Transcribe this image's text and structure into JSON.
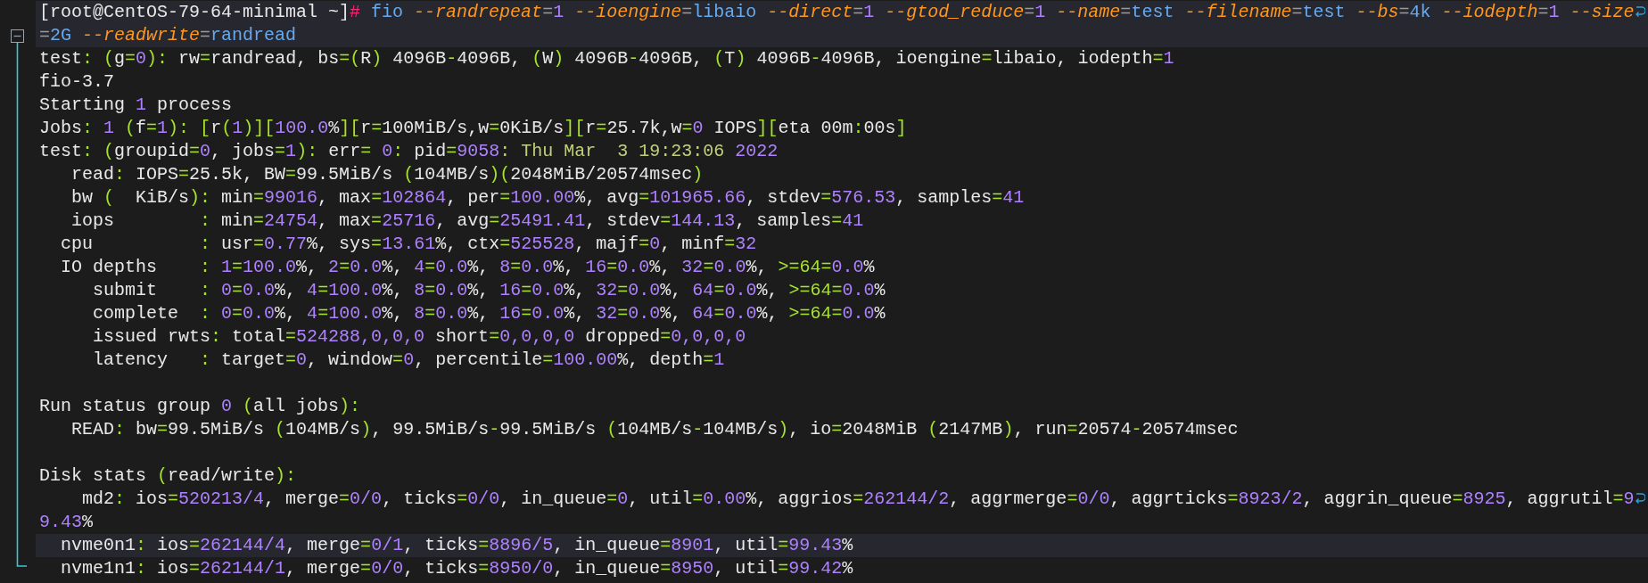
{
  "editor": {
    "fold": {
      "expanded": true
    },
    "lines": [
      {
        "kind": "text",
        "highlighted": true,
        "wrapped": true,
        "tokens": [
          {
            "kind": "plain",
            "text": "[root@CentOS-79-64-minimal ~]"
          },
          {
            "kind": "prompt",
            "text": "#"
          },
          {
            "kind": "command",
            "text": " fio "
          },
          {
            "kind": "flag",
            "text": "--randrepeat"
          },
          {
            "kind": "operator",
            "text": "="
          },
          {
            "kind": "number",
            "text": "1"
          },
          {
            "kind": "flag",
            "text": " --ioengine"
          },
          {
            "kind": "operator",
            "text": "="
          },
          {
            "kind": "value",
            "text": "libaio"
          },
          {
            "kind": "flag",
            "text": " --direct"
          },
          {
            "kind": "operator",
            "text": "="
          },
          {
            "kind": "number",
            "text": "1"
          },
          {
            "kind": "flag",
            "text": " --gtod_reduce"
          },
          {
            "kind": "operator",
            "text": "="
          },
          {
            "kind": "number",
            "text": "1"
          },
          {
            "kind": "flag",
            "text": " --name"
          },
          {
            "kind": "operator",
            "text": "="
          },
          {
            "kind": "value",
            "text": "test"
          },
          {
            "kind": "flag",
            "text": " --filename"
          },
          {
            "kind": "operator",
            "text": "="
          },
          {
            "kind": "value",
            "text": "test"
          },
          {
            "kind": "flag",
            "text": " --bs"
          },
          {
            "kind": "operator",
            "text": "="
          },
          {
            "kind": "value",
            "text": "4k"
          },
          {
            "kind": "flag",
            "text": " --iodepth"
          },
          {
            "kind": "operator",
            "text": "="
          },
          {
            "kind": "number",
            "text": "1"
          },
          {
            "kind": "flag",
            "text": " --size"
          }
        ]
      },
      {
        "kind": "text",
        "highlighted": true,
        "wrapped": false,
        "tokens": [
          {
            "kind": "operator",
            "text": "="
          },
          {
            "kind": "value",
            "text": "2G"
          },
          {
            "kind": "flag",
            "text": " --readwrite"
          },
          {
            "kind": "operator",
            "text": "="
          },
          {
            "kind": "value",
            "text": "randread"
          }
        ]
      },
      {
        "kind": "text",
        "highlighted": false,
        "wrapped": false,
        "tokens": [
          {
            "kind": "plain",
            "text": "test"
          },
          {
            "kind": "punct",
            "text": ": ("
          },
          {
            "kind": "plain",
            "text": "g"
          },
          {
            "kind": "punct",
            "text": "="
          },
          {
            "kind": "number",
            "text": "0"
          },
          {
            "kind": "punct",
            "text": "):"
          },
          {
            "kind": "plain",
            "text": " rw"
          },
          {
            "kind": "punct",
            "text": "="
          },
          {
            "kind": "plain",
            "text": "randread, bs"
          },
          {
            "kind": "punct",
            "text": "=("
          },
          {
            "kind": "plain",
            "text": "R"
          },
          {
            "kind": "punct",
            "text": ")"
          },
          {
            "kind": "plain",
            "text": " 4096B"
          },
          {
            "kind": "punct",
            "text": "-"
          },
          {
            "kind": "plain",
            "text": "4096B, "
          },
          {
            "kind": "punct",
            "text": "("
          },
          {
            "kind": "plain",
            "text": "W"
          },
          {
            "kind": "punct",
            "text": ")"
          },
          {
            "kind": "plain",
            "text": " 4096B"
          },
          {
            "kind": "punct",
            "text": "-"
          },
          {
            "kind": "plain",
            "text": "4096B, "
          },
          {
            "kind": "punct",
            "text": "("
          },
          {
            "kind": "plain",
            "text": "T"
          },
          {
            "kind": "punct",
            "text": ")"
          },
          {
            "kind": "plain",
            "text": " 4096B"
          },
          {
            "kind": "punct",
            "text": "-"
          },
          {
            "kind": "plain",
            "text": "4096B, ioengine"
          },
          {
            "kind": "punct",
            "text": "="
          },
          {
            "kind": "plain",
            "text": "libaio, iodepth"
          },
          {
            "kind": "punct",
            "text": "="
          },
          {
            "kind": "number",
            "text": "1"
          }
        ]
      },
      {
        "kind": "text",
        "highlighted": false,
        "wrapped": false,
        "tokens": [
          {
            "kind": "plain",
            "text": "fio-3.7"
          }
        ]
      },
      {
        "kind": "text",
        "highlighted": false,
        "wrapped": false,
        "tokens": [
          {
            "kind": "plain",
            "text": "Starting "
          },
          {
            "kind": "number",
            "text": "1"
          },
          {
            "kind": "plain",
            "text": " process"
          }
        ]
      },
      {
        "kind": "text",
        "highlighted": false,
        "wrapped": false,
        "tokens": [
          {
            "kind": "plain",
            "text": "Jobs"
          },
          {
            "kind": "punct",
            "text": ": "
          },
          {
            "kind": "number",
            "text": "1"
          },
          {
            "kind": "punct",
            "text": " ("
          },
          {
            "kind": "plain",
            "text": "f"
          },
          {
            "kind": "punct",
            "text": "="
          },
          {
            "kind": "number",
            "text": "1"
          },
          {
            "kind": "punct",
            "text": "): ["
          },
          {
            "kind": "plain",
            "text": "r"
          },
          {
            "kind": "punct",
            "text": "("
          },
          {
            "kind": "number",
            "text": "1"
          },
          {
            "kind": "punct",
            "text": ")]["
          },
          {
            "kind": "number",
            "text": "100.0"
          },
          {
            "kind": "plain",
            "text": "%"
          },
          {
            "kind": "punct",
            "text": "]["
          },
          {
            "kind": "plain",
            "text": "r"
          },
          {
            "kind": "punct",
            "text": "="
          },
          {
            "kind": "plain",
            "text": "100MiB/s,w"
          },
          {
            "kind": "punct",
            "text": "="
          },
          {
            "kind": "plain",
            "text": "0KiB/s"
          },
          {
            "kind": "punct",
            "text": "]["
          },
          {
            "kind": "plain",
            "text": "r"
          },
          {
            "kind": "punct",
            "text": "="
          },
          {
            "kind": "plain",
            "text": "25.7k,w"
          },
          {
            "kind": "punct",
            "text": "="
          },
          {
            "kind": "number",
            "text": "0"
          },
          {
            "kind": "plain",
            "text": " IOPS"
          },
          {
            "kind": "punct",
            "text": "]["
          },
          {
            "kind": "plain",
            "text": "eta 00m"
          },
          {
            "kind": "punct",
            "text": ":"
          },
          {
            "kind": "plain",
            "text": "00s"
          },
          {
            "kind": "punct",
            "text": "]"
          }
        ]
      },
      {
        "kind": "text",
        "highlighted": false,
        "wrapped": false,
        "tokens": [
          {
            "kind": "plain",
            "text": "test"
          },
          {
            "kind": "punct",
            "text": ": ("
          },
          {
            "kind": "plain",
            "text": "groupid"
          },
          {
            "kind": "punct",
            "text": "="
          },
          {
            "kind": "number",
            "text": "0"
          },
          {
            "kind": "plain",
            "text": ", jobs"
          },
          {
            "kind": "punct",
            "text": "="
          },
          {
            "kind": "number",
            "text": "1"
          },
          {
            "kind": "punct",
            "text": "):"
          },
          {
            "kind": "plain",
            "text": " err"
          },
          {
            "kind": "punct",
            "text": "="
          },
          {
            "kind": "number",
            "text": " 0"
          },
          {
            "kind": "punct",
            "text": ":"
          },
          {
            "kind": "plain",
            "text": " pid"
          },
          {
            "kind": "punct",
            "text": "="
          },
          {
            "kind": "number",
            "text": "9058"
          },
          {
            "kind": "date",
            "text": ": Thu Mar  3 19:23:06 "
          },
          {
            "kind": "number",
            "text": "2022"
          }
        ]
      },
      {
        "kind": "text",
        "highlighted": false,
        "wrapped": false,
        "tokens": [
          {
            "kind": "plain",
            "text": "   read"
          },
          {
            "kind": "punct",
            "text": ":"
          },
          {
            "kind": "plain",
            "text": " IOPS"
          },
          {
            "kind": "punct",
            "text": "="
          },
          {
            "kind": "plain",
            "text": "25.5k, BW"
          },
          {
            "kind": "punct",
            "text": "="
          },
          {
            "kind": "plain",
            "text": "99.5MiB/s "
          },
          {
            "kind": "punct",
            "text": "("
          },
          {
            "kind": "plain",
            "text": "104MB/s"
          },
          {
            "kind": "punct",
            "text": ")("
          },
          {
            "kind": "plain",
            "text": "2048MiB/20574msec"
          },
          {
            "kind": "punct",
            "text": ")"
          }
        ]
      },
      {
        "kind": "text",
        "highlighted": false,
        "wrapped": false,
        "tokens": [
          {
            "kind": "plain",
            "text": "   bw "
          },
          {
            "kind": "punct",
            "text": "("
          },
          {
            "kind": "plain",
            "text": "  KiB/s"
          },
          {
            "kind": "punct",
            "text": "):"
          },
          {
            "kind": "plain",
            "text": " min"
          },
          {
            "kind": "punct",
            "text": "="
          },
          {
            "kind": "number",
            "text": "99016"
          },
          {
            "kind": "plain",
            "text": ", max"
          },
          {
            "kind": "punct",
            "text": "="
          },
          {
            "kind": "number",
            "text": "102864"
          },
          {
            "kind": "plain",
            "text": ", per"
          },
          {
            "kind": "punct",
            "text": "="
          },
          {
            "kind": "number",
            "text": "100.00"
          },
          {
            "kind": "plain",
            "text": "%, avg"
          },
          {
            "kind": "punct",
            "text": "="
          },
          {
            "kind": "number",
            "text": "101965.66"
          },
          {
            "kind": "plain",
            "text": ", stdev"
          },
          {
            "kind": "punct",
            "text": "="
          },
          {
            "kind": "number",
            "text": "576.53"
          },
          {
            "kind": "plain",
            "text": ", samples"
          },
          {
            "kind": "punct",
            "text": "="
          },
          {
            "kind": "number",
            "text": "41"
          }
        ]
      },
      {
        "kind": "text",
        "highlighted": false,
        "wrapped": false,
        "tokens": [
          {
            "kind": "plain",
            "text": "   iops        "
          },
          {
            "kind": "punct",
            "text": ":"
          },
          {
            "kind": "plain",
            "text": " min"
          },
          {
            "kind": "punct",
            "text": "="
          },
          {
            "kind": "number",
            "text": "24754"
          },
          {
            "kind": "plain",
            "text": ", max"
          },
          {
            "kind": "punct",
            "text": "="
          },
          {
            "kind": "number",
            "text": "25716"
          },
          {
            "kind": "plain",
            "text": ", avg"
          },
          {
            "kind": "punct",
            "text": "="
          },
          {
            "kind": "number",
            "text": "25491.41"
          },
          {
            "kind": "plain",
            "text": ", stdev"
          },
          {
            "kind": "punct",
            "text": "="
          },
          {
            "kind": "number",
            "text": "144.13"
          },
          {
            "kind": "plain",
            "text": ", samples"
          },
          {
            "kind": "punct",
            "text": "="
          },
          {
            "kind": "number",
            "text": "41"
          }
        ]
      },
      {
        "kind": "text",
        "highlighted": false,
        "wrapped": false,
        "tokens": [
          {
            "kind": "plain",
            "text": "  cpu          "
          },
          {
            "kind": "punct",
            "text": ":"
          },
          {
            "kind": "plain",
            "text": " usr"
          },
          {
            "kind": "punct",
            "text": "="
          },
          {
            "kind": "number",
            "text": "0.77"
          },
          {
            "kind": "plain",
            "text": "%, sys"
          },
          {
            "kind": "punct",
            "text": "="
          },
          {
            "kind": "number",
            "text": "13.61"
          },
          {
            "kind": "plain",
            "text": "%, ctx"
          },
          {
            "kind": "punct",
            "text": "="
          },
          {
            "kind": "number",
            "text": "525528"
          },
          {
            "kind": "plain",
            "text": ", majf"
          },
          {
            "kind": "punct",
            "text": "="
          },
          {
            "kind": "number",
            "text": "0"
          },
          {
            "kind": "plain",
            "text": ", minf"
          },
          {
            "kind": "punct",
            "text": "="
          },
          {
            "kind": "number",
            "text": "32"
          }
        ]
      },
      {
        "kind": "text",
        "highlighted": false,
        "wrapped": false,
        "tokens": [
          {
            "kind": "plain",
            "text": "  IO depths    "
          },
          {
            "kind": "punct",
            "text": ": "
          },
          {
            "kind": "number",
            "text": "1"
          },
          {
            "kind": "punct",
            "text": "="
          },
          {
            "kind": "number",
            "text": "100.0"
          },
          {
            "kind": "plain",
            "text": "%, "
          },
          {
            "kind": "number",
            "text": "2"
          },
          {
            "kind": "punct",
            "text": "="
          },
          {
            "kind": "number",
            "text": "0.0"
          },
          {
            "kind": "plain",
            "text": "%, "
          },
          {
            "kind": "number",
            "text": "4"
          },
          {
            "kind": "punct",
            "text": "="
          },
          {
            "kind": "number",
            "text": "0.0"
          },
          {
            "kind": "plain",
            "text": "%, "
          },
          {
            "kind": "number",
            "text": "8"
          },
          {
            "kind": "punct",
            "text": "="
          },
          {
            "kind": "number",
            "text": "0.0"
          },
          {
            "kind": "plain",
            "text": "%, "
          },
          {
            "kind": "number",
            "text": "16"
          },
          {
            "kind": "punct",
            "text": "="
          },
          {
            "kind": "number",
            "text": "0.0"
          },
          {
            "kind": "plain",
            "text": "%, "
          },
          {
            "kind": "number",
            "text": "32"
          },
          {
            "kind": "punct",
            "text": "="
          },
          {
            "kind": "number",
            "text": "0.0"
          },
          {
            "kind": "plain",
            "text": "%, "
          },
          {
            "kind": "punct",
            "text": ">=64="
          },
          {
            "kind": "number",
            "text": "0.0"
          },
          {
            "kind": "plain",
            "text": "%"
          }
        ]
      },
      {
        "kind": "text",
        "highlighted": false,
        "wrapped": false,
        "tokens": [
          {
            "kind": "plain",
            "text": "     submit    "
          },
          {
            "kind": "punct",
            "text": ": "
          },
          {
            "kind": "number",
            "text": "0"
          },
          {
            "kind": "punct",
            "text": "="
          },
          {
            "kind": "number",
            "text": "0.0"
          },
          {
            "kind": "plain",
            "text": "%, "
          },
          {
            "kind": "number",
            "text": "4"
          },
          {
            "kind": "punct",
            "text": "="
          },
          {
            "kind": "number",
            "text": "100.0"
          },
          {
            "kind": "plain",
            "text": "%, "
          },
          {
            "kind": "number",
            "text": "8"
          },
          {
            "kind": "punct",
            "text": "="
          },
          {
            "kind": "number",
            "text": "0.0"
          },
          {
            "kind": "plain",
            "text": "%, "
          },
          {
            "kind": "number",
            "text": "16"
          },
          {
            "kind": "punct",
            "text": "="
          },
          {
            "kind": "number",
            "text": "0.0"
          },
          {
            "kind": "plain",
            "text": "%, "
          },
          {
            "kind": "number",
            "text": "32"
          },
          {
            "kind": "punct",
            "text": "="
          },
          {
            "kind": "number",
            "text": "0.0"
          },
          {
            "kind": "plain",
            "text": "%, "
          },
          {
            "kind": "number",
            "text": "64"
          },
          {
            "kind": "punct",
            "text": "="
          },
          {
            "kind": "number",
            "text": "0.0"
          },
          {
            "kind": "plain",
            "text": "%, "
          },
          {
            "kind": "punct",
            "text": ">=64="
          },
          {
            "kind": "number",
            "text": "0.0"
          },
          {
            "kind": "plain",
            "text": "%"
          }
        ]
      },
      {
        "kind": "text",
        "highlighted": false,
        "wrapped": false,
        "tokens": [
          {
            "kind": "plain",
            "text": "     complete  "
          },
          {
            "kind": "punct",
            "text": ": "
          },
          {
            "kind": "number",
            "text": "0"
          },
          {
            "kind": "punct",
            "text": "="
          },
          {
            "kind": "number",
            "text": "0.0"
          },
          {
            "kind": "plain",
            "text": "%, "
          },
          {
            "kind": "number",
            "text": "4"
          },
          {
            "kind": "punct",
            "text": "="
          },
          {
            "kind": "number",
            "text": "100.0"
          },
          {
            "kind": "plain",
            "text": "%, "
          },
          {
            "kind": "number",
            "text": "8"
          },
          {
            "kind": "punct",
            "text": "="
          },
          {
            "kind": "number",
            "text": "0.0"
          },
          {
            "kind": "plain",
            "text": "%, "
          },
          {
            "kind": "number",
            "text": "16"
          },
          {
            "kind": "punct",
            "text": "="
          },
          {
            "kind": "number",
            "text": "0.0"
          },
          {
            "kind": "plain",
            "text": "%, "
          },
          {
            "kind": "number",
            "text": "32"
          },
          {
            "kind": "punct",
            "text": "="
          },
          {
            "kind": "number",
            "text": "0.0"
          },
          {
            "kind": "plain",
            "text": "%, "
          },
          {
            "kind": "number",
            "text": "64"
          },
          {
            "kind": "punct",
            "text": "="
          },
          {
            "kind": "number",
            "text": "0.0"
          },
          {
            "kind": "plain",
            "text": "%, "
          },
          {
            "kind": "punct",
            "text": ">=64="
          },
          {
            "kind": "number",
            "text": "0.0"
          },
          {
            "kind": "plain",
            "text": "%"
          }
        ]
      },
      {
        "kind": "text",
        "highlighted": false,
        "wrapped": false,
        "tokens": [
          {
            "kind": "plain",
            "text": "     issued rwts"
          },
          {
            "kind": "punct",
            "text": ":"
          },
          {
            "kind": "plain",
            "text": " total"
          },
          {
            "kind": "punct",
            "text": "="
          },
          {
            "kind": "number",
            "text": "524288,0,0,0"
          },
          {
            "kind": "plain",
            "text": " short"
          },
          {
            "kind": "punct",
            "text": "="
          },
          {
            "kind": "number",
            "text": "0,0,0,0"
          },
          {
            "kind": "plain",
            "text": " dropped"
          },
          {
            "kind": "punct",
            "text": "="
          },
          {
            "kind": "number",
            "text": "0,0,0,0"
          }
        ]
      },
      {
        "kind": "text",
        "highlighted": false,
        "wrapped": false,
        "tokens": [
          {
            "kind": "plain",
            "text": "     latency   "
          },
          {
            "kind": "punct",
            "text": ":"
          },
          {
            "kind": "plain",
            "text": " target"
          },
          {
            "kind": "punct",
            "text": "="
          },
          {
            "kind": "number",
            "text": "0"
          },
          {
            "kind": "plain",
            "text": ", window"
          },
          {
            "kind": "punct",
            "text": "="
          },
          {
            "kind": "number",
            "text": "0"
          },
          {
            "kind": "plain",
            "text": ", percentile"
          },
          {
            "kind": "punct",
            "text": "="
          },
          {
            "kind": "number",
            "text": "100.00"
          },
          {
            "kind": "plain",
            "text": "%, depth"
          },
          {
            "kind": "punct",
            "text": "="
          },
          {
            "kind": "number",
            "text": "1"
          }
        ]
      },
      {
        "kind": "blank"
      },
      {
        "kind": "text",
        "highlighted": false,
        "wrapped": false,
        "tokens": [
          {
            "kind": "plain",
            "text": "Run status group "
          },
          {
            "kind": "number",
            "text": "0"
          },
          {
            "kind": "punct",
            "text": " ("
          },
          {
            "kind": "plain",
            "text": "all jobs"
          },
          {
            "kind": "punct",
            "text": "):"
          }
        ]
      },
      {
        "kind": "text",
        "highlighted": false,
        "wrapped": false,
        "tokens": [
          {
            "kind": "plain",
            "text": "   READ"
          },
          {
            "kind": "punct",
            "text": ":"
          },
          {
            "kind": "plain",
            "text": " bw"
          },
          {
            "kind": "punct",
            "text": "="
          },
          {
            "kind": "plain",
            "text": "99.5MiB/s "
          },
          {
            "kind": "punct",
            "text": "("
          },
          {
            "kind": "plain",
            "text": "104MB/s"
          },
          {
            "kind": "punct",
            "text": ")"
          },
          {
            "kind": "plain",
            "text": ", 99.5MiB/s"
          },
          {
            "kind": "punct",
            "text": "-"
          },
          {
            "kind": "plain",
            "text": "99.5MiB/s "
          },
          {
            "kind": "punct",
            "text": "("
          },
          {
            "kind": "plain",
            "text": "104MB/s"
          },
          {
            "kind": "punct",
            "text": "-"
          },
          {
            "kind": "plain",
            "text": "104MB/s"
          },
          {
            "kind": "punct",
            "text": ")"
          },
          {
            "kind": "plain",
            "text": ", io"
          },
          {
            "kind": "punct",
            "text": "="
          },
          {
            "kind": "plain",
            "text": "2048MiB "
          },
          {
            "kind": "punct",
            "text": "("
          },
          {
            "kind": "plain",
            "text": "2147MB"
          },
          {
            "kind": "punct",
            "text": ")"
          },
          {
            "kind": "plain",
            "text": ", run"
          },
          {
            "kind": "punct",
            "text": "="
          },
          {
            "kind": "plain",
            "text": "20574"
          },
          {
            "kind": "punct",
            "text": "-"
          },
          {
            "kind": "plain",
            "text": "20574msec"
          }
        ]
      },
      {
        "kind": "blank"
      },
      {
        "kind": "text",
        "highlighted": false,
        "wrapped": false,
        "tokens": [
          {
            "kind": "plain",
            "text": "Disk stats "
          },
          {
            "kind": "punct",
            "text": "("
          },
          {
            "kind": "plain",
            "text": "read/write"
          },
          {
            "kind": "punct",
            "text": "):"
          }
        ]
      },
      {
        "kind": "text",
        "highlighted": false,
        "wrapped": true,
        "tokens": [
          {
            "kind": "plain",
            "text": "    md2"
          },
          {
            "kind": "punct",
            "text": ":"
          },
          {
            "kind": "plain",
            "text": " ios"
          },
          {
            "kind": "punct",
            "text": "="
          },
          {
            "kind": "number",
            "text": "520213/4"
          },
          {
            "kind": "plain",
            "text": ", merge"
          },
          {
            "kind": "punct",
            "text": "="
          },
          {
            "kind": "number",
            "text": "0/0"
          },
          {
            "kind": "plain",
            "text": ", ticks"
          },
          {
            "kind": "punct",
            "text": "="
          },
          {
            "kind": "number",
            "text": "0/0"
          },
          {
            "kind": "plain",
            "text": ", in_queue"
          },
          {
            "kind": "punct",
            "text": "="
          },
          {
            "kind": "number",
            "text": "0"
          },
          {
            "kind": "plain",
            "text": ", util"
          },
          {
            "kind": "punct",
            "text": "="
          },
          {
            "kind": "number",
            "text": "0.00"
          },
          {
            "kind": "plain",
            "text": "%, aggrios"
          },
          {
            "kind": "punct",
            "text": "="
          },
          {
            "kind": "number",
            "text": "262144/2"
          },
          {
            "kind": "plain",
            "text": ", aggrmerge"
          },
          {
            "kind": "punct",
            "text": "="
          },
          {
            "kind": "number",
            "text": "0/0"
          },
          {
            "kind": "plain",
            "text": ", aggrticks"
          },
          {
            "kind": "punct",
            "text": "="
          },
          {
            "kind": "number",
            "text": "8923/2"
          },
          {
            "kind": "plain",
            "text": ", aggrin_queue"
          },
          {
            "kind": "punct",
            "text": "="
          },
          {
            "kind": "number",
            "text": "8925"
          },
          {
            "kind": "plain",
            "text": ", aggrutil"
          },
          {
            "kind": "punct",
            "text": "="
          },
          {
            "kind": "number",
            "text": "9"
          }
        ]
      },
      {
        "kind": "text",
        "highlighted": false,
        "wrapped": false,
        "tokens": [
          {
            "kind": "number",
            "text": "9.43"
          },
          {
            "kind": "plain",
            "text": "%"
          }
        ]
      },
      {
        "kind": "text",
        "highlighted": true,
        "wrapped": false,
        "tokens": [
          {
            "kind": "plain",
            "text": "  nvme0n1"
          },
          {
            "kind": "punct",
            "text": ":"
          },
          {
            "kind": "plain",
            "text": " ios"
          },
          {
            "kind": "punct",
            "text": "="
          },
          {
            "kind": "number",
            "text": "262144/4"
          },
          {
            "kind": "plain",
            "text": ", merge"
          },
          {
            "kind": "punct",
            "text": "="
          },
          {
            "kind": "number",
            "text": "0/1"
          },
          {
            "kind": "plain",
            "text": ", ticks"
          },
          {
            "kind": "punct",
            "text": "="
          },
          {
            "kind": "number",
            "text": "8896/5"
          },
          {
            "kind": "plain",
            "text": ", in_queue"
          },
          {
            "kind": "punct",
            "text": "="
          },
          {
            "kind": "number",
            "text": "8901"
          },
          {
            "kind": "plain",
            "text": ", util"
          },
          {
            "kind": "punct",
            "text": "="
          },
          {
            "kind": "number",
            "text": "99.43"
          },
          {
            "kind": "plain",
            "text": "%"
          }
        ]
      },
      {
        "kind": "text",
        "highlighted": false,
        "wrapped": false,
        "tokens": [
          {
            "kind": "plain",
            "text": "  nvme1n1"
          },
          {
            "kind": "punct",
            "text": ":"
          },
          {
            "kind": "plain",
            "text": " ios"
          },
          {
            "kind": "punct",
            "text": "="
          },
          {
            "kind": "number",
            "text": "262144/1"
          },
          {
            "kind": "plain",
            "text": ", merge"
          },
          {
            "kind": "punct",
            "text": "="
          },
          {
            "kind": "number",
            "text": "0/0"
          },
          {
            "kind": "plain",
            "text": ", ticks"
          },
          {
            "kind": "punct",
            "text": "="
          },
          {
            "kind": "number",
            "text": "8950/0"
          },
          {
            "kind": "plain",
            "text": ", in_queue"
          },
          {
            "kind": "punct",
            "text": "="
          },
          {
            "kind": "number",
            "text": "8950"
          },
          {
            "kind": "plain",
            "text": ", util"
          },
          {
            "kind": "punct",
            "text": "="
          },
          {
            "kind": "number",
            "text": "99.42"
          },
          {
            "kind": "plain",
            "text": "%"
          }
        ]
      }
    ]
  }
}
